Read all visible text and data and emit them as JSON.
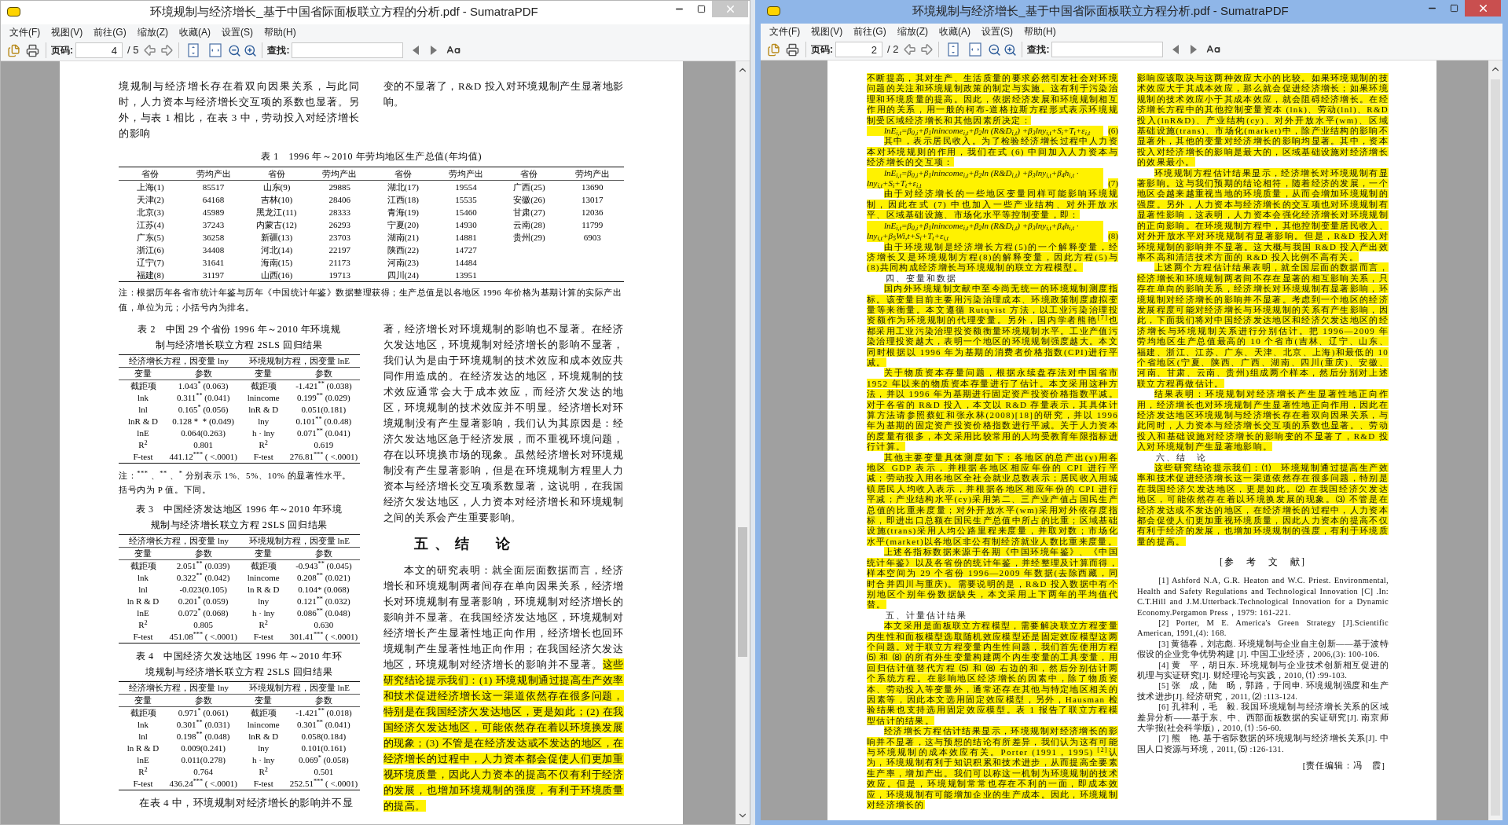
{
  "windows": [
    {
      "title": "环境规制与经济增长_基于中国省际面板联立方程的分析.pdf - SumatraPDF",
      "active": false,
      "menu": [
        "文件(F)",
        "视图(V)",
        "前往(G)",
        "缩放(Z)",
        "收藏(A)",
        "设置(S)",
        "帮助(H)"
      ],
      "toolbar": {
        "page_label": "页码:",
        "page_number": "4",
        "page_count": "/ 5",
        "find_label": "查找:"
      },
      "document": {
        "kind": "with_tables",
        "top_columns": [
          [
            {
              "kind": "continuation",
              "text": "境规制与经济增长存在着双向因果关系，与此同时，人力资本与经济增长交互项的系数也显著。另外，与表 1 相比，在表 3 中，劳动投入对经济增长的影响",
              "highlighted": false
            }
          ],
          [
            {
              "kind": "continuation",
              "text": "变的不显著了，R&D 投入对环境规制产生显著地影响。",
              "highlighted": false
            }
          ]
        ],
        "wide_table": {
          "caption": "表 1　1996 年～2010 年劳均地区生产总值(年均值)",
          "header": [
            "省份",
            "劳均产出",
            "省份",
            "劳均产出",
            "省份",
            "劳均产出",
            "省份",
            "劳均产出"
          ],
          "rows": [
            [
              "上海(1)",
              "85517",
              "山东(9)",
              "29885",
              "湖北(17)",
              "19554",
              "广西(25)",
              "13690"
            ],
            [
              "天津(2)",
              "64168",
              "吉林(10)",
              "28406",
              "江西(18)",
              "15535",
              "安徽(26)",
              "13017"
            ],
            [
              "北京(3)",
              "45989",
              "黑龙江(11)",
              "28333",
              "青海(19)",
              "15460",
              "甘肃(27)",
              "12036"
            ],
            [
              "江苏(4)",
              "37243",
              "内蒙古(12)",
              "26293",
              "宁夏(20)",
              "14930",
              "云南(28)",
              "11799"
            ],
            [
              "广东(5)",
              "36258",
              "新疆(13)",
              "23703",
              "湖南(21)",
              "14881",
              "贵州(29)",
              "6903"
            ],
            [
              "浙江(6)",
              "34408",
              "河北(14)",
              "22197",
              "陕西(22)",
              "14727"
            ],
            [
              "辽宁(7)",
              "31641",
              "海南(15)",
              "21173",
              "河南(23)",
              "14484"
            ],
            [
              "福建(8)",
              "31197",
              "山西(16)",
              "19713",
              "四川(24)",
              "13951"
            ]
          ],
          "note": "注：根据历年各省市统计年鉴与历年《中国统计年鉴》数据整理获得；生产总值是以各地区 1996 年价格为基期计算的实际产出值，单位为元；小括号内为排名。"
        },
        "columns": [
          [
            {
              "kind": "table",
              "caption": "表 2　中国 29 个省份 1996 年～2010 年环境规制与经济增长联立方程 2SLS 回归结果",
              "groups": [
                "经济增长方程，因变量 lny",
                "环境规制方程，因变量 lnE"
              ],
              "headers": [
                "变量",
                "参数",
                "变量",
                "参数"
              ],
              "rows": [
                [
                  "截距项",
                  "1.043$^{*}$ (0.063)",
                  "截距项",
                  "-1.421$^{**}$ (0.038)"
                ],
                [
                  "lnk",
                  "0.311$^{**}$ (0.041)",
                  "lnincome",
                  "0.199$^{**}$ (0.029)"
                ],
                [
                  "lnl",
                  "0.165$^{*}$ (0.056)",
                  "lnR & D",
                  "0.051(0.181)"
                ],
                [
                  "lnR & D",
                  "0.128＊＊(0.049)",
                  "lny",
                  "0.101$^{**}$ (0.0.48)"
                ],
                [
                  "lnE",
                  "0.064(0.263)",
                  "h · lny",
                  "0.071$^{**}$ (0.041)"
                ],
                [
                  "R$^{2}$",
                  "0.801",
                  "R$^{2}$",
                  "0.619"
                ],
                [
                  "F-test",
                  "441.12$^{***}$ ( <.0001)",
                  "F-test",
                  "276.81$^{***}$ ( <.0001)"
                ]
              ]
            },
            {
              "kind": "note",
              "text": "注：$^{***}$ 、$^{**}$ 、$^{*}$ 分别表示 1%、5%、10% 的显著性水平。括号内为 P 值。下同。"
            },
            {
              "kind": "table",
              "caption": "表 3　中国经济发达地区 1996 年～2010 年环境规制与经济增长联立方程 2SLS 回归结果",
              "groups": [
                "经济增长方程，因变量 lny",
                "环境规制方程，因变量 lnE"
              ],
              "headers": [
                "变量",
                "参数",
                "变量",
                "参数"
              ],
              "rows": [
                [
                  "截距项",
                  "2.051$^{**}$ (0.039)",
                  "截距项",
                  "-0.943$^{**}$ (0.045)"
                ],
                [
                  "lnk",
                  "0.322$^{**}$ (0.042)",
                  "lnincome",
                  "0.208$^{**}$ (0.021)"
                ],
                [
                  "lnl",
                  "-0.023(0.105)",
                  "ln R & D",
                  "0.104* (0.068)"
                ],
                [
                  "ln R & D",
                  "0.201$^{*}$ (0.059)",
                  "lny",
                  "0.121$^{**}$ (0.032)"
                ],
                [
                  "lnE",
                  "0.072$^{*}$ (0.068)",
                  "h · lny",
                  "0.086$^{**}$ (0.048)"
                ],
                [
                  "R$^{2}$",
                  "0.805",
                  "R$^{2}$",
                  "0.630"
                ],
                [
                  "F-test",
                  "451.08$^{***}$ ( <.0001)",
                  "F-test",
                  "301.41$^{***}$ ( <.0001)"
                ]
              ]
            },
            {
              "kind": "table",
              "caption": "表 4　中国经济欠发达地区 1996 年～2010 年环境规制与经济增长联立方程 2SLS 回归结果",
              "groups": [
                "经济增长方程，因变量 lny",
                "环境规制方程，因变量 lnE"
              ],
              "headers": [
                "变量",
                "参数",
                "变量",
                "参数"
              ],
              "rows": [
                [
                  "截距项",
                  "0.971$^{*}$ (0.061)",
                  "截距项",
                  "-1.421$^{**}$ (0.018)"
                ],
                [
                  "lnk",
                  "0.301$^{**}$ (0.031)",
                  "lnincome",
                  "0.301$^{**}$ (0.041)"
                ],
                [
                  "lnl",
                  "0.198$^{**}$ (0.048)",
                  "lnR & D",
                  "0.058(0.184)"
                ],
                [
                  "ln R & D",
                  "0.009(0.241)",
                  "lny",
                  "0.101(0.161)"
                ],
                [
                  "lnE",
                  "0.011(0.278)",
                  "h · lny",
                  "0.069$^{*}$ (0.058)"
                ],
                [
                  "R$^{2}$",
                  "0.764",
                  "R$^{2}$",
                  "0.501"
                ],
                [
                  "F-test",
                  "436.24$^{***}$ ( <.0001)",
                  "F-test",
                  "252.51$^{***}$ ( <.0001)"
                ]
              ]
            },
            {
              "kind": "paragraph",
              "text": "在表 4 中，环境规制对经济增长的影响并不显",
              "highlighted": false
            }
          ],
          [
            {
              "kind": "continuation",
              "text": "著，经济增长对环境规制的影响也不显著。在经济欠发达地区，环境规制对经济增长的影响不显著，我们认为是由于环境规制的技术效应和成本效应共同作用造成的。在经济发达的地区，环境规制的技术效应通常会大于成本效应，而经济欠发达的地区，环境规制的技术效应并不明显。经济增长对环境规制没有产生显著影响，我们认为其原因是：经济欠发达地区急于经济发展，而不重视环境问题，存在以环境换市场的现象。虽然经济增长对环境规制没有产生显著影响，但是在环境规制方程里人力资本与经济增长交互项系数显著，这说明，在我国经济欠发达地区，人力资本对经济增长和环境规制之间的关系会产生重要影响。",
              "highlighted": false
            },
            {
              "kind": "heading",
              "text": "五、结　论"
            },
            {
              "kind": "paragraph",
              "segments": [
                {
                  "text": "本文的研究表明：就全面层面数据而言，经济增长和环境规制两者间存在单向因果关系，经济增长对环境规制有显著影响，环境规制对经济增长的影响并不显著。在我国经济发达地区，环境规制对经济增长产生显著性地正向作用，经济增长也回环境规制产生显著性地正向作用；在我国经济欠发达地区，环境规制对经济增长的影响并不显著。",
                  "highlighted": false
                },
                {
                  "text": "这些研究结论提示我们：(1) 环境规制通过提高生产效率和技术促进经济增长这一渠道依然存在很多问题，特别是在我国经济欠发达地区，更是如此；(2) 在我国经济欠发达地区，可能依然存在着以环境换发展的现象；(3) 不管是在经济发达或不发达的地区，在经济增长的过程中，人力资本都会促使人们更加重视环境质量，因此人力资本的提高不仅有利于经济的发展，也增加环境规制的强度，有利于环境质量的提高。",
                  "highlighted": true
                }
              ]
            }
          ]
        ]
      }
    },
    {
      "title": "环境规制与经济增长_基于中国省际面板联立方程分析.pdf - SumatraPDF",
      "active": true,
      "menu": [
        "文件(F)",
        "视图(V)",
        "前往(G)",
        "缩放(Z)",
        "收藏(A)",
        "设置(S)",
        "帮助(H)"
      ],
      "toolbar": {
        "page_label": "页码:",
        "page_number": "2",
        "page_count": "/ 2",
        "find_label": "查找:"
      },
      "document": {
        "kind": "text_only",
        "columns": [
          [
            {
              "kind": "continuation",
              "text": "不断提高，其对生产、生活质量的要求必然引发社会对环境问题的关注和环境规制政策的制定与实施。这有利于污染治理和环境质量的提高。因此，依据经济发展和环境规制相互作用的关系，用一般的柯布-道格拉斯方程形式表示环境规制受区域经济增长和其他因素所决定：",
              "highlighted": true
            },
            {
              "kind": "equation",
              "text": "lnE$_{i,t}$=β$_{0,i}$+β$_{1}$lnincome$_{i,t}$+β$_{2}$ln (R&D$_{i,t}$) +β$_{3}$lny$_{i,t}$+S$_{i}$+T$_{t}$+ε$_{i,t}$",
              "number": "(6)",
              "highlighted": true
            },
            {
              "kind": "paragraph",
              "text": "其中，表示居民收入。为了检验经济增长过程中人力资本对环境规则的作用，我们在式 (6) 中间加入人力资本与经济增长的交互项：",
              "highlighted": true
            },
            {
              "kind": "equation",
              "text": "lnE$_{i,t}$=β$_{0,i}$+β$_{1}$lnincome$_{i,t}$+β$_{2}$ln (R&D$_{i,t}$) +β$_{3}$lny$_{i,t}$+β$_{4}$h$_{i,t}$ · lny$_{i,t}$+S$_{i}$+T$_{t}$+ε$_{i,t}$",
              "number": "(7)",
              "highlighted": true
            },
            {
              "kind": "paragraph",
              "text": "由于对经济增长的一些地区变量同样可能影响环境规制，因此在式 (7) 中也加入一些产业结构、对外开放水平、区域基础设施、市场化水平等控制变量，即：",
              "highlighted": true
            },
            {
              "kind": "equation",
              "text": "lnE$_{i,t}$=β$_{0,i}$+β$_{1}$lnincome$_{i,t}$+β$_{2}$ln (R&D$_{i,t}$) +β$_{3}$lny$_{i,t}$+β$_{4}$h$_{i,t}$ · lny$_{i,t}$+β$_{5}$Wi,t+S$_{i}$+T$_{t}$+ε$_{i,t}$",
              "number": "(8)",
              "highlighted": true
            },
            {
              "kind": "paragraph",
              "text": "由于环境规制是经济增长方程(5)的一个解释变量，经济增长又是环境规制方程(8)的解释变量，因此方程(5)与(8)共同构成经济增长与环境规制的联立方程模型。",
              "highlighted": true
            },
            {
              "kind": "heading",
              "text": "四、变量和数据"
            },
            {
              "kind": "paragraph",
              "text": "国内外环境规制文献中至今尚无统一的环境规制测度指标。该变量目前主要用污染治理成本、环境政策制度虚拟变量等来衡量。本文遵循 Rutqvist 方法，以工业污染治理投资额作为环境规制的代理变量。另外，国内学者熊艳$^{[7]}$也都采用工业污染治理投资额衡量环境规制水平。工业产值污染治理投资越大，表明一个地区的环境规制强度越大。本文同时根据以 1996 年为基期的消费者价格指数(CPI)进行平减。",
              "highlighted": true
            },
            {
              "kind": "paragraph",
              "text": "关于物质资本存量问题，根据永续盘存法对中国省市 1952 年以来的物质资本存量进行了估计。本文采用这种方法，并以 1996 年为基期进行固定资产投资价格指数平减。对于各省的 R&D 投入，本文以 R&D 存量表示，其具体计算方法请参照蔡虹和张永林(2008)[18]的研究，并以 1996 年为基期的固定资产投资价格指数进行平减。关于人力资本的度量有很多，本文采用比较常用的人均受教育年限指标进行计算。",
              "highlighted": true
            },
            {
              "kind": "paragraph",
              "text": "其他主要变量具体测度如下：各地区的总产出(y)用各地区 GDP 表示，并根据各地区相应年份的 CPI 进行平减；劳动投入用各地区全社会就业总数表示；居民收入用城镇居民人均收入表示，并根据各地区相应年份的 CPI 进行平减；产业结构水平(cy)采用第二、三产业产值占国民生产总值的比重来度量；对外开放水平(wm)采用对外依存度指标，即进出口总额在国民生产总值中所占的比重；区域基础设施(trans)采用人均公路里程来度量，并取对数；市场化水平(market)以各地区非公有制经济就业人数比重来度量。",
              "highlighted": true
            },
            {
              "kind": "paragraph",
              "text": "上述各指标数据来源于各期《中国环境年鉴》、《中国统计年鉴》以及各省份的统计年鉴，并经整理及计算而得，样本空间为 29 个省份 1996—2009 年数据(去除西藏，同时合并四川与重庆)。需要说明的是，R&D 投入数据中有个别地区个别年份数据缺失，本文采用上下两年的平均值代替。",
              "highlighted": true
            },
            {
              "kind": "heading",
              "text": "五、计量估计结果"
            },
            {
              "kind": "paragraph",
              "text": "本文采用是面板联立方程模型，需要解决联立方程变量内生性和面板模型选取随机效应模型还是固定效应模型这两个问题。对于联立方程变量内生性问题，我们首先使用方程 ⑸ 和 ⑻ 的所有外生变量构建两个内生变量的工具变量，用回归估计值替代方程 ⑸ 和 ⑻ 右边的和，然后分别估计两个系统方程。在影响地区经济增长的因素中，除了物质资本、劳动投入等变量外，通常还存在其他与特定地区相关的因素等，因此本文选用固定效应模型，另外，Hausman 检验结果也支持选用固定效应模型。表 1 报告了联立方程模型估计的结果。",
              "highlighted": true
            },
            {
              "kind": "paragraph",
              "text": "经济增长方程估计结果显示，环境规制对经济增长的影响并不显著，这与预想的结论有所差异，我们认为这有可能与环境规制的成本效应有关。Porter (1991，1995) $^{[2]}$认为，环境规制有利于知识积累和技术进步，从而提高全要素生产率，增加产出。我们可以称这一机制为环境规制的技术效应。但是，环境规制常常也存在不利的一面，即成本效应，环境规制有可能增加企业的生产成本。因此，环境规制对经济增长的",
              "highlighted": true
            }
          ],
          [
            {
              "kind": "continuation",
              "text": "影响应该取决与这两种效应大小的比较。如果环境规制的技术效应大于其成本效应，那么就会促进经济增长；如果环境规制的技术效应小于其成本效应，就会阻碍经济增长。在经济增长方程中的其他控制变量资本 (lnk)、劳动(lnl)、R&D 投入(lnR&D)、产业结构(cy)、对外开放水平(wm)、区域基础设施(trans)、市场化(market)中，除产业结构的影响不显著外，其他的变量对经济增长的影响均显著。其中，资本投入对经济增长的影响是最大的，区域基础设施对经济增长的效果最小。",
              "highlighted": true
            },
            {
              "kind": "paragraph",
              "text": "环境规制方程估计结果显示，经济增长对环境规制有显著影响。这与我们预期的结论相符，随着经济的发展，一个地区会越来越重视当地的环境质量，从而会增加环境规制的强度。另外，人力资本与经济增长的交互项也对环境规制有显著性影响，这表明，人力资本会强化经济增长对环境规制的正向影响。在环境规制方程中，其他控制变量居民收入、对外开放水平对环境规制有显著影响。但是，R&D 投入对环境规制的影响并不显著。这大概与我国 R&D 投入产出效率不高和清洁技术方面的 R&D 投入比例不高有关。",
              "highlighted": true
            },
            {
              "kind": "paragraph",
              "text": "上述两个方程估计结果表明，就全国层面的数据而言，经济增长和环境规制两者间不存在显著的相互影响关系，只存在单向的影响关系，经济增长对环境规制有显著影响，环境规制对经济增长的影响并不显著。考虑到一个地区的经济发展程度可能对经济增长与环境规制的关系有产生影响，因此，下面我们将对中国经济发达地区和经济欠发达地区的经济增长与环境规制关系进行分别估计。把 1996—2009 年劳均地区生产总值最高的 10 个省市(吉林、辽宁、山东、福建、浙江、江苏、广东、天津、北京、上海)和最低的 10 个省地区(宁夏、陕西、广西、湖南、四川(重庆)、安徽、河南、甘肃、云南、贵州)组成两个样本，然后分别对上述联立方程再做估计。",
              "highlighted": true
            },
            {
              "kind": "paragraph",
              "text": "结果表明：环境规制对经济增长产生显著性地正向作用，经济增长也对环境规制产生显著性地正向作用，因此在经济发达地区环境规制与经济增长存在着双向因果关系，与此同时，人力资本与经济增长交互项的系数也显著。、劳动投入和基础设施对经济增长的影响变的不显著了，R&D 投入对环境规制产生显著地影响。",
              "highlighted": true
            },
            {
              "kind": "heading",
              "text": "六、结　论"
            },
            {
              "kind": "paragraph",
              "text": "这些研究结论提示我们：⑴　环境规制通过提高生产效率和技术促进经济增长这一渠道依然存在很多问题，特别是在我国经济欠发达地区，更是如此。⑵ 在我国经济欠发达地区，可能依然存在着以环境换发展的现象。⑶ 不管是在经济发达或不发达的地区，在经济增长的过程中，人力资本都会促使人们更加重视环境质量，因此人力资本的提高不仅有利于经济的发展，也增加环境规制的强度，有利于环境质量的提高。",
              "highlighted": true
            },
            {
              "kind": "references_title",
              "text": "[参　考　文　献]"
            },
            {
              "kind": "reference",
              "text": "[1] Ashford N.A, G.R. Heaton and W.C. Priest. Environmental, Health and Safety Regulations and Technological Innovation [C] .In: C.T.Hill and J.M.Utterback.Technological Innovation for a Dynamic Economy.Pergamon Press，1979: 161-221."
            },
            {
              "kind": "reference",
              "text": "[2] Porter, M E. America's Green Strategy [J].Scientific American, 1991,(4): 168."
            },
            {
              "kind": "reference",
              "text": "[3] 黄德春，刘志彪. 环境规制与企业自主创新——基于波特假设的企业竞争优势构建 [J]. 中国工业经济，2006,(3): 100-106."
            },
            {
              "kind": "reference",
              "text": "[4] 黄　平，胡日东. 环境规制与企业技术创新相互促进的机理与实证研究[J]. 财经理论与实践，2010, ⑴ :99-103."
            },
            {
              "kind": "reference",
              "text": "[5] 张　成，陆　旸，郭路，于同申. 环境规制强度和生产技术进步[J]. 经济研究，2011, ⑵ :113-124."
            },
            {
              "kind": "reference",
              "text": "[6] 孔祥利，毛　毅. 我国环境规制与经济增长关系的区域差异分析——基于东、中、西部面板数据的实证研究[J]. 南京师大学报(社会科学版)，2010, ⑴ :56-60."
            },
            {
              "kind": "reference",
              "text": "[7] 熊　艳. 基于省际数据的环境规制与经济增长关系[J]. 中国人口资源与环境，2011, ⑸ :126-131."
            },
            {
              "kind": "editor",
              "text": "[责任编辑：冯　霞]"
            }
          ]
        ]
      }
    }
  ]
}
